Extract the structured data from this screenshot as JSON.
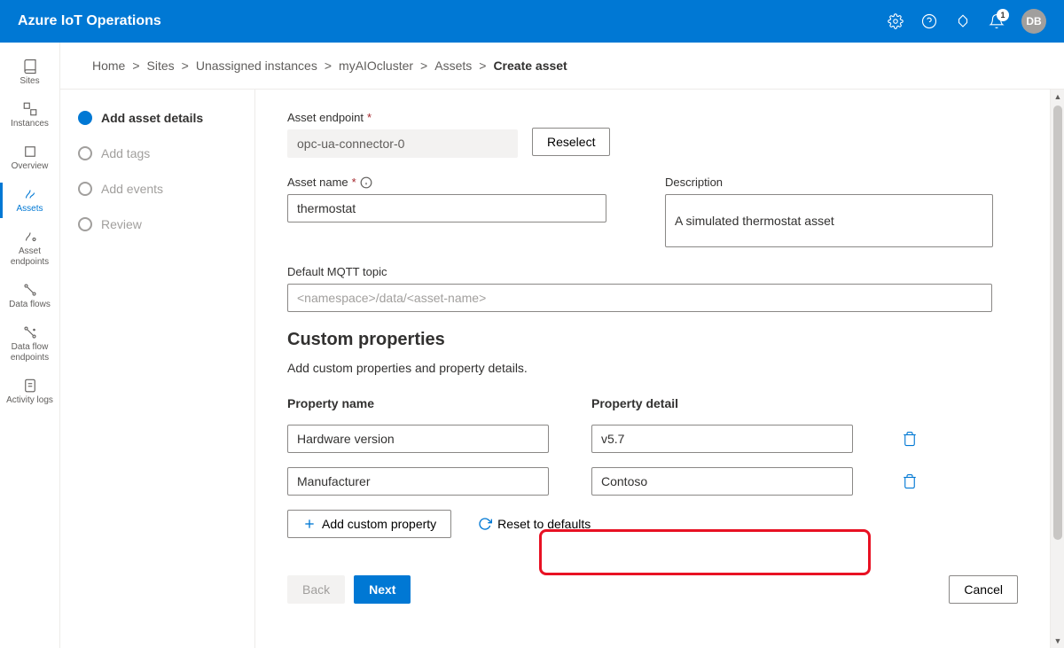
{
  "header": {
    "title": "Azure IoT Operations",
    "notification_count": "1",
    "avatar_initials": "DB"
  },
  "sidenav": [
    {
      "id": "sites",
      "label": "Sites"
    },
    {
      "id": "instances",
      "label": "Instances"
    },
    {
      "id": "overview",
      "label": "Overview"
    },
    {
      "id": "assets",
      "label": "Assets",
      "active": true
    },
    {
      "id": "asset-endpoints",
      "label": "Asset endpoints"
    },
    {
      "id": "data-flows",
      "label": "Data flows"
    },
    {
      "id": "data-flow-endpoints",
      "label": "Data flow endpoints"
    },
    {
      "id": "activity-logs",
      "label": "Activity logs"
    }
  ],
  "breadcrumb": {
    "items": [
      "Home",
      "Sites",
      "Unassigned instances",
      "myAIOcluster",
      "Assets"
    ],
    "current": "Create asset",
    "sep": ">"
  },
  "steps": [
    {
      "label": "Add asset details",
      "active": true
    },
    {
      "label": "Add tags"
    },
    {
      "label": "Add events"
    },
    {
      "label": "Review"
    }
  ],
  "form": {
    "endpoint_label": "Asset endpoint",
    "endpoint_value": "opc-ua-connector-0",
    "reselect_label": "Reselect",
    "name_label": "Asset name",
    "name_value": "thermostat",
    "desc_label": "Description",
    "desc_value": "A simulated thermostat asset",
    "mqtt_label": "Default MQTT topic",
    "mqtt_placeholder": "<namespace>/data/<asset-name>",
    "custom_title": "Custom properties",
    "custom_desc": "Add custom properties and property details.",
    "prop_name_header": "Property name",
    "prop_detail_header": "Property detail",
    "properties": [
      {
        "name": "Hardware version",
        "detail": "v5.7"
      },
      {
        "name": "Manufacturer",
        "detail": "Contoso"
      }
    ],
    "add_prop_label": "Add custom property",
    "reset_label": "Reset to defaults"
  },
  "footer": {
    "back": "Back",
    "next": "Next",
    "cancel": "Cancel"
  }
}
